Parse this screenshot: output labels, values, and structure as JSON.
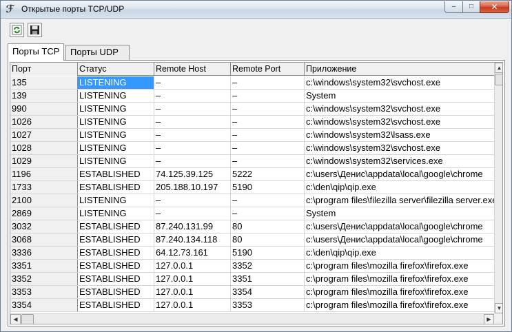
{
  "window": {
    "title": "Открытые порты TCP/UDP",
    "buttons": {
      "minimize": "–",
      "maximize": "□",
      "close": "✕"
    }
  },
  "toolbar": {
    "refresh_icon": "refresh-icon",
    "save_icon": "save-icon"
  },
  "tabs": [
    {
      "label": "Порты TCP",
      "active": true
    },
    {
      "label": "Порты UDP",
      "active": false
    }
  ],
  "table": {
    "columns": [
      "Порт",
      "Статус",
      "Remote Host",
      "Remote Port",
      "Приложение"
    ],
    "rows": [
      [
        "135",
        "LISTENING",
        "–",
        "–",
        "c:\\windows\\system32\\svchost.exe"
      ],
      [
        "139",
        "LISTENING",
        "–",
        "–",
        "System"
      ],
      [
        "990",
        "LISTENING",
        "–",
        "–",
        "c:\\windows\\system32\\svchost.exe"
      ],
      [
        "1026",
        "LISTENING",
        "–",
        "–",
        "c:\\windows\\system32\\svchost.exe"
      ],
      [
        "1027",
        "LISTENING",
        "–",
        "–",
        "c:\\windows\\system32\\lsass.exe"
      ],
      [
        "1028",
        "LISTENING",
        "–",
        "–",
        "c:\\windows\\system32\\svchost.exe"
      ],
      [
        "1029",
        "LISTENING",
        "–",
        "–",
        "c:\\windows\\system32\\services.exe"
      ],
      [
        "1196",
        "ESTABLISHED",
        "74.125.39.125",
        "5222",
        "c:\\users\\Денис\\appdata\\local\\google\\chrome"
      ],
      [
        "1733",
        "ESTABLISHED",
        "205.188.10.197",
        "5190",
        "c:\\den\\qip\\qip.exe"
      ],
      [
        "2100",
        "LISTENING",
        "–",
        "–",
        "c:\\program files\\filezilla server\\filezilla server.exe"
      ],
      [
        "2869",
        "LISTENING",
        "–",
        "–",
        "System"
      ],
      [
        "3032",
        "ESTABLISHED",
        "87.240.131.99",
        "80",
        "c:\\users\\Денис\\appdata\\local\\google\\chrome"
      ],
      [
        "3068",
        "ESTABLISHED",
        "87.240.134.118",
        "80",
        "c:\\users\\Денис\\appdata\\local\\google\\chrome"
      ],
      [
        "3336",
        "ESTABLISHED",
        "64.12.73.161",
        "5190",
        "c:\\den\\qip\\qip.exe"
      ],
      [
        "3351",
        "ESTABLISHED",
        "127.0.0.1",
        "3352",
        "c:\\program files\\mozilla firefox\\firefox.exe"
      ],
      [
        "3352",
        "ESTABLISHED",
        "127.0.0.1",
        "3351",
        "c:\\program files\\mozilla firefox\\firefox.exe"
      ],
      [
        "3353",
        "ESTABLISHED",
        "127.0.0.1",
        "3354",
        "c:\\program files\\mozilla firefox\\firefox.exe"
      ],
      [
        "3354",
        "ESTABLISHED",
        "127.0.0.1",
        "3353",
        "c:\\program files\\mozilla firefox\\firefox.exe"
      ]
    ],
    "selected_row": 0,
    "selected_col": 1,
    "selection_color": "#3399ff"
  }
}
